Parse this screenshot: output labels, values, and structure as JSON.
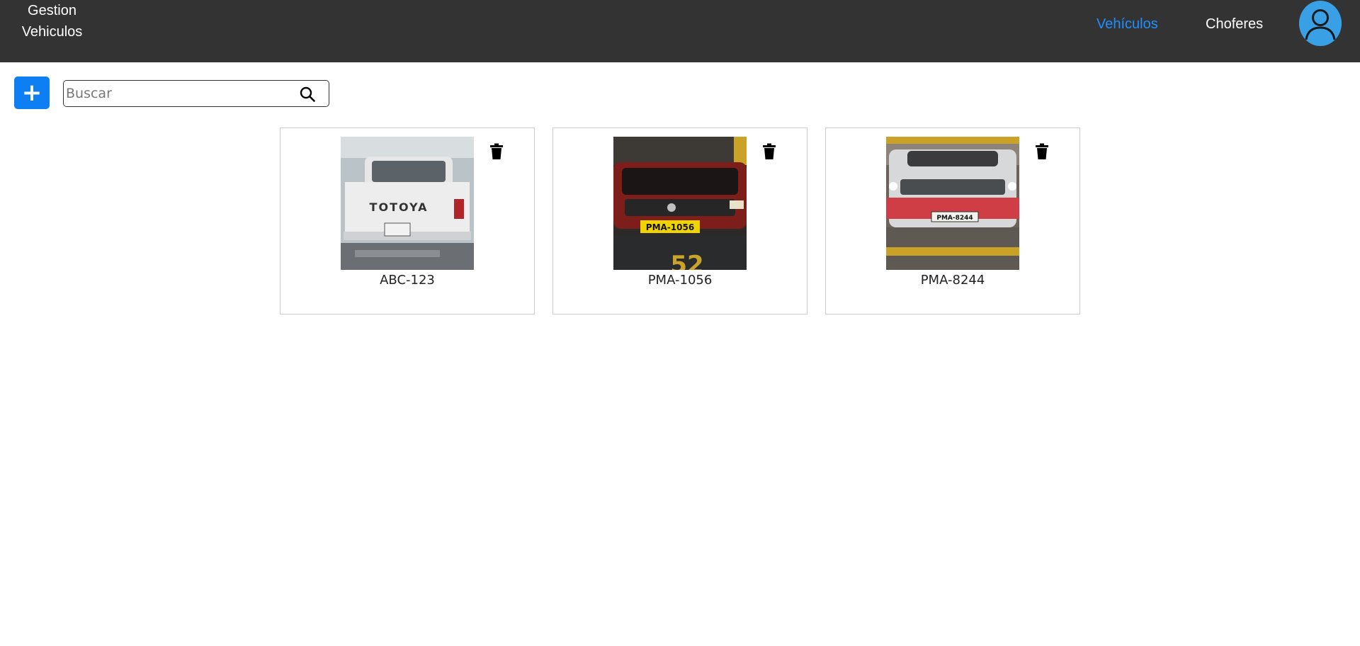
{
  "navbar": {
    "brand_line1": "Gestion",
    "brand_line2": "Vehiculos",
    "links": [
      {
        "label": "Vehículos",
        "active": true,
        "color": "#1e90ff"
      },
      {
        "label": "Choferes",
        "active": false,
        "color": "#ffffff"
      }
    ],
    "avatar_icon": "user-avatar-icon",
    "background_color": "#333333"
  },
  "toolbar": {
    "add_icon": "plus-icon",
    "add_label": "+",
    "add_color": "#0d7ff3",
    "search": {
      "placeholder": "Buscar",
      "value": "",
      "icon": "search-icon"
    }
  },
  "vehicles": [
    {
      "plate": "ABC-123",
      "photo_text": "TOTOYA",
      "delete_icon": "trash-icon"
    },
    {
      "plate": "PMA-1056",
      "photo_text": "PMA-1056",
      "photo_overlay": "52",
      "delete_icon": "trash-icon"
    },
    {
      "plate": "PMA-8244",
      "photo_text": "PMA-8244",
      "delete_icon": "trash-icon"
    }
  ]
}
